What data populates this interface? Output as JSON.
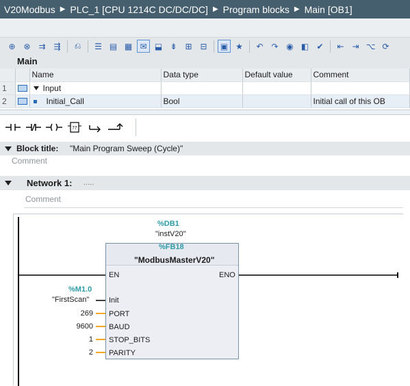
{
  "breadcrumb": [
    "V20Modbus",
    "PLC_1 [CPU 1214C DC/DC/DC]",
    "Program blocks",
    "Main [OB1]"
  ],
  "interface": {
    "title": "Main",
    "columns": [
      "Name",
      "Data type",
      "Default value",
      "Comment"
    ],
    "rows": [
      {
        "num": "1",
        "name": "Input",
        "type": "",
        "default": "",
        "comment": ""
      },
      {
        "num": "2",
        "name": "Initial_Call",
        "type": "Bool",
        "default": "",
        "comment": "Initial call of this OB"
      }
    ]
  },
  "block": {
    "title_label": "Block title:",
    "title_value": "\"Main Program Sweep (Cycle)\"",
    "comment_placeholder": "Comment"
  },
  "network": {
    "label": "Network 1:",
    "title_placeholder": ".....",
    "comment_placeholder": "Comment"
  },
  "fb": {
    "instance_address": "%DB1",
    "instance_name": "\"instV20\"",
    "fb_address": "%FB18",
    "fb_name": "\"ModbusMasterV20\"",
    "en": "EN",
    "eno": "ENO",
    "params": [
      {
        "name": "Init",
        "address": "%M1.0",
        "value": "\"FirstScan\""
      },
      {
        "name": "PORT",
        "value": "269"
      },
      {
        "name": "BAUD",
        "value": "9600"
      },
      {
        "name": "STOP_BITS",
        "value": "1"
      },
      {
        "name": "PARITY",
        "value": "2"
      }
    ]
  },
  "colors": {
    "title_bar": "#465f6e",
    "accent_teal": "#2c9ba8",
    "param_orange": "#f5a623",
    "wire": "#000000"
  }
}
